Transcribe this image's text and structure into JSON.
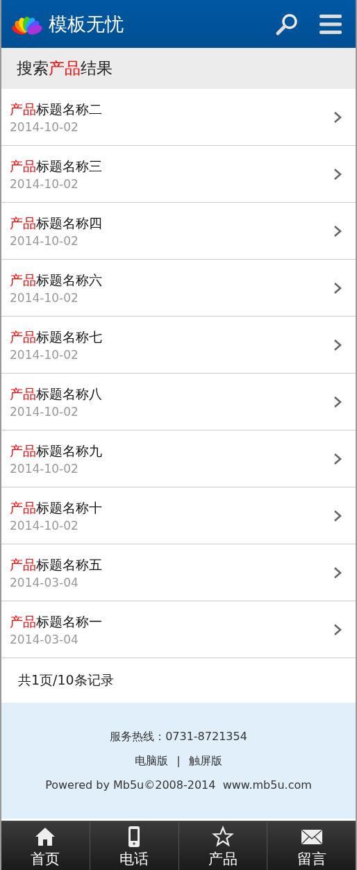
{
  "header": {
    "logo_text": "模板无忧"
  },
  "heading": {
    "prefix": "搜索",
    "highlight": "产品",
    "suffix": "结果"
  },
  "results": [
    {
      "highlight": "产品",
      "title": "标题名称二",
      "date": "2014-10-02"
    },
    {
      "highlight": "产品",
      "title": "标题名称三",
      "date": "2014-10-02"
    },
    {
      "highlight": "产品",
      "title": "标题名称四",
      "date": "2014-10-02"
    },
    {
      "highlight": "产品",
      "title": "标题名称六",
      "date": "2014-10-02"
    },
    {
      "highlight": "产品",
      "title": "标题名称七",
      "date": "2014-10-02"
    },
    {
      "highlight": "产品",
      "title": "标题名称八",
      "date": "2014-10-02"
    },
    {
      "highlight": "产品",
      "title": "标题名称九",
      "date": "2014-10-02"
    },
    {
      "highlight": "产品",
      "title": "标题名称十",
      "date": "2014-10-02"
    },
    {
      "highlight": "产品",
      "title": "标题名称五",
      "date": "2014-03-04"
    },
    {
      "highlight": "产品",
      "title": "标题名称一",
      "date": "2014-03-04"
    }
  ],
  "pagination": "共1页/10条记录",
  "footer": {
    "hotline": "服务热线：0731-8721354",
    "links": [
      "电脑版",
      "触屏版"
    ],
    "separator": "|",
    "powered": "Powered by Mb5u©2008-2014  www.mb5u.com"
  },
  "bottom_nav": [
    {
      "kind": "home",
      "label": "首页"
    },
    {
      "kind": "phone",
      "label": "电话"
    },
    {
      "kind": "star",
      "label": "产品"
    },
    {
      "kind": "mail",
      "label": "留言"
    }
  ]
}
